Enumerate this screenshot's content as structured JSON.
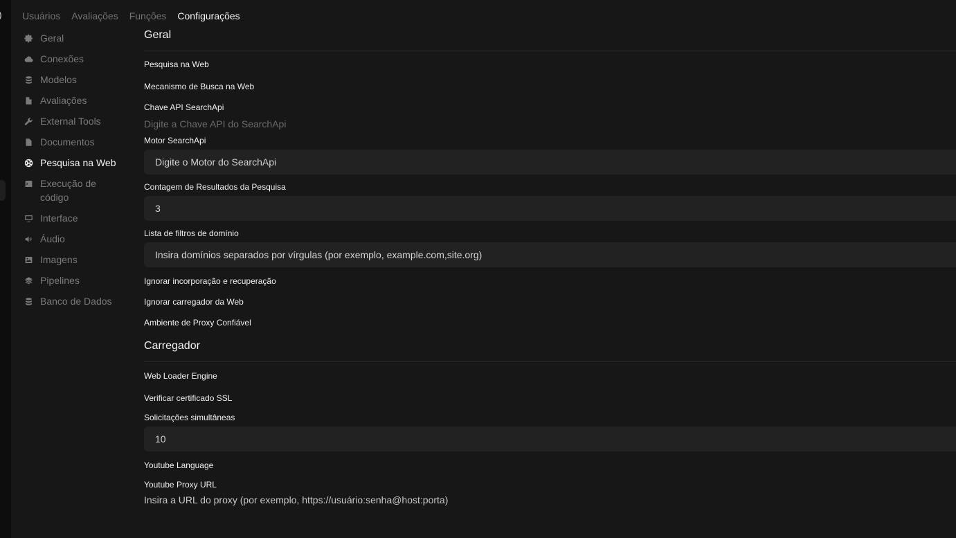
{
  "nav": {
    "tabs": [
      {
        "label": "Usuários"
      },
      {
        "label": "Avaliações"
      },
      {
        "label": "Funções"
      },
      {
        "label": "Configurações"
      }
    ]
  },
  "sidebar": {
    "items": [
      {
        "label": "Geral",
        "icon": "gear-icon"
      },
      {
        "label": "Conexões",
        "icon": "cloud-icon"
      },
      {
        "label": "Modelos",
        "icon": "database-icon"
      },
      {
        "label": "Avaliações",
        "icon": "document-icon"
      },
      {
        "label": "External Tools",
        "icon": "wrench-icon"
      },
      {
        "label": "Documentos",
        "icon": "document-text-icon"
      },
      {
        "label": "Pesquisa na Web",
        "icon": "globe-icon"
      },
      {
        "label": "Execução de código",
        "icon": "terminal-icon"
      },
      {
        "label": "Interface",
        "icon": "monitor-icon"
      },
      {
        "label": "Áudio",
        "icon": "speaker-icon"
      },
      {
        "label": "Imagens",
        "icon": "image-icon"
      },
      {
        "label": "Pipelines",
        "icon": "layers-icon"
      },
      {
        "label": "Banco de Dados",
        "icon": "database-icon"
      }
    ]
  },
  "main": {
    "general": {
      "title": "Geral",
      "web_search_label": "Pesquisa na Web",
      "search_engine_label": "Mecanismo de Busca na Web",
      "searchapi_key_label": "Chave API SearchApi",
      "searchapi_key_placeholder": "Digite a Chave API do SearchApi",
      "searchapi_engine_label": "Motor SearchApi",
      "searchapi_engine_placeholder": "Digite o Motor do SearchApi",
      "result_count_label": "Contagem de Resultados da Pesquisa",
      "result_count_value": "3",
      "domain_filter_label": "Lista de filtros de domínio",
      "domain_filter_placeholder": "Insira domínios separados por vírgulas (por exemplo, example.com,site.org)",
      "bypass_embedding_label": "Ignorar incorporação e recuperação",
      "bypass_loader_label": "Ignorar carregador da Web",
      "trust_proxy_label": "Ambiente de Proxy Confiável"
    },
    "loader": {
      "title": "Carregador",
      "engine_label": "Web Loader Engine",
      "verify_ssl_label": "Verificar certificado SSL",
      "concurrent_label": "Solicitações simultâneas",
      "concurrent_value": "10",
      "youtube_language_label": "Youtube Language",
      "youtube_proxy_label": "Youtube Proxy URL",
      "youtube_proxy_placeholder": "Insira a URL do proxy (por exemplo, https://usuário:senha@host:porta)"
    }
  }
}
